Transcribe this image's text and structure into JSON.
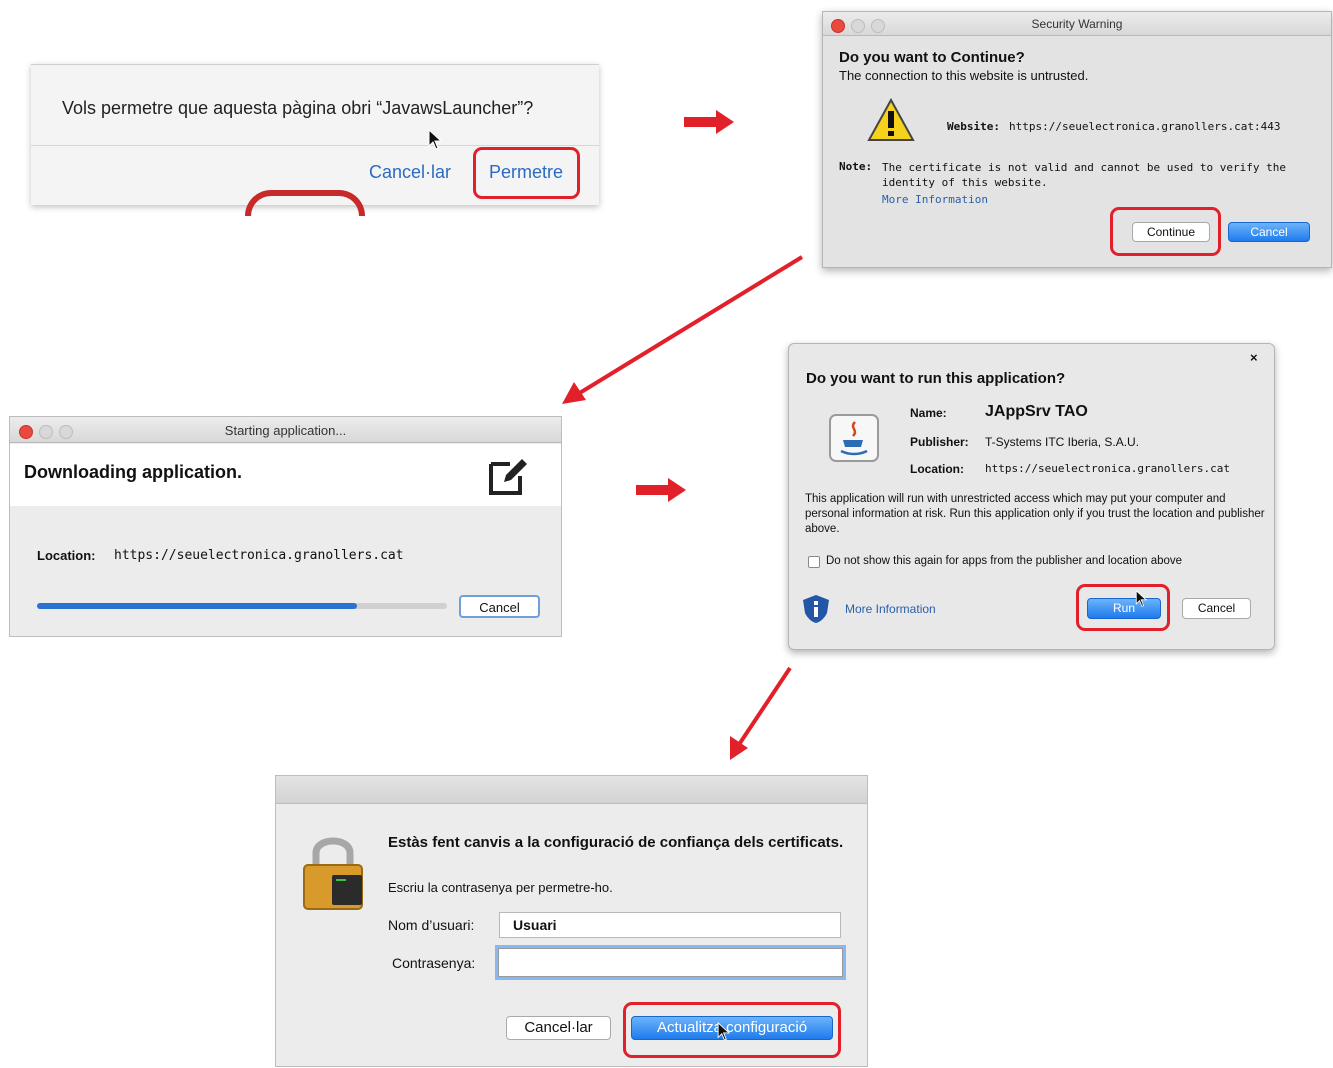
{
  "step1": {
    "question": "Vols permetre que aquesta pàgina obri “JavawsLauncher”?",
    "cancel_label": "Cancel·lar",
    "allow_label": "Permetre"
  },
  "step2": {
    "window_title": "Security Warning",
    "heading": "Do you want to Continue?",
    "subheading": "The connection to this website is untrusted.",
    "website_label": "Website:",
    "website_value": "https://seuelectronica.granollers.cat:443",
    "note_label": "Note:",
    "note_text": "The certificate is not valid and cannot be used to verify the identity of this website.",
    "more_info": "More Information",
    "continue_label": "Continue",
    "cancel_label": "Cancel"
  },
  "step3": {
    "window_title": "Starting application...",
    "heading": "Downloading application.",
    "location_label": "Location:",
    "location_value": "https://seuelectronica.granollers.cat",
    "progress": 0.78,
    "cancel_label": "Cancel"
  },
  "step4": {
    "close_glyph": "×",
    "heading": "Do you want to run this application?",
    "name_label": "Name:",
    "name_value": "JAppSrv TAO",
    "publisher_label": "Publisher:",
    "publisher_value": "T-Systems ITC Iberia, S.A.U.",
    "location_label": "Location:",
    "location_value": "https://seuelectronica.granollers.cat",
    "warning_text": "This application will run with unrestricted access which may put your computer and personal information at risk. Run this application only if you trust the location and publisher above.",
    "checkbox_label": "Do not show this again for apps from the publisher and location above",
    "more_info": "More Information",
    "run_label": "Run",
    "cancel_label": "Cancel"
  },
  "step5": {
    "heading": "Estàs fent canvis a la configuració de confiança dels certificats.",
    "subtext": "Escriu la contrasenya per permetre-ho.",
    "username_label": "Nom d’usuari:",
    "username_value": "Usuari",
    "password_label": "Contrasenya:",
    "password_value": "",
    "cancel_label": "Cancel·lar",
    "update_label": "Actualitza configuració"
  },
  "colors": {
    "arrow_red": "#e2202a",
    "highlight_red": "#e2202a",
    "mac_blue": "#1f7bed",
    "progress_blue": "#2a72d0"
  },
  "icons": [
    "cursor-icon",
    "warning-icon",
    "edit-icon",
    "java-icon",
    "info-shield-icon",
    "padlock-icon",
    "close-icon"
  ]
}
